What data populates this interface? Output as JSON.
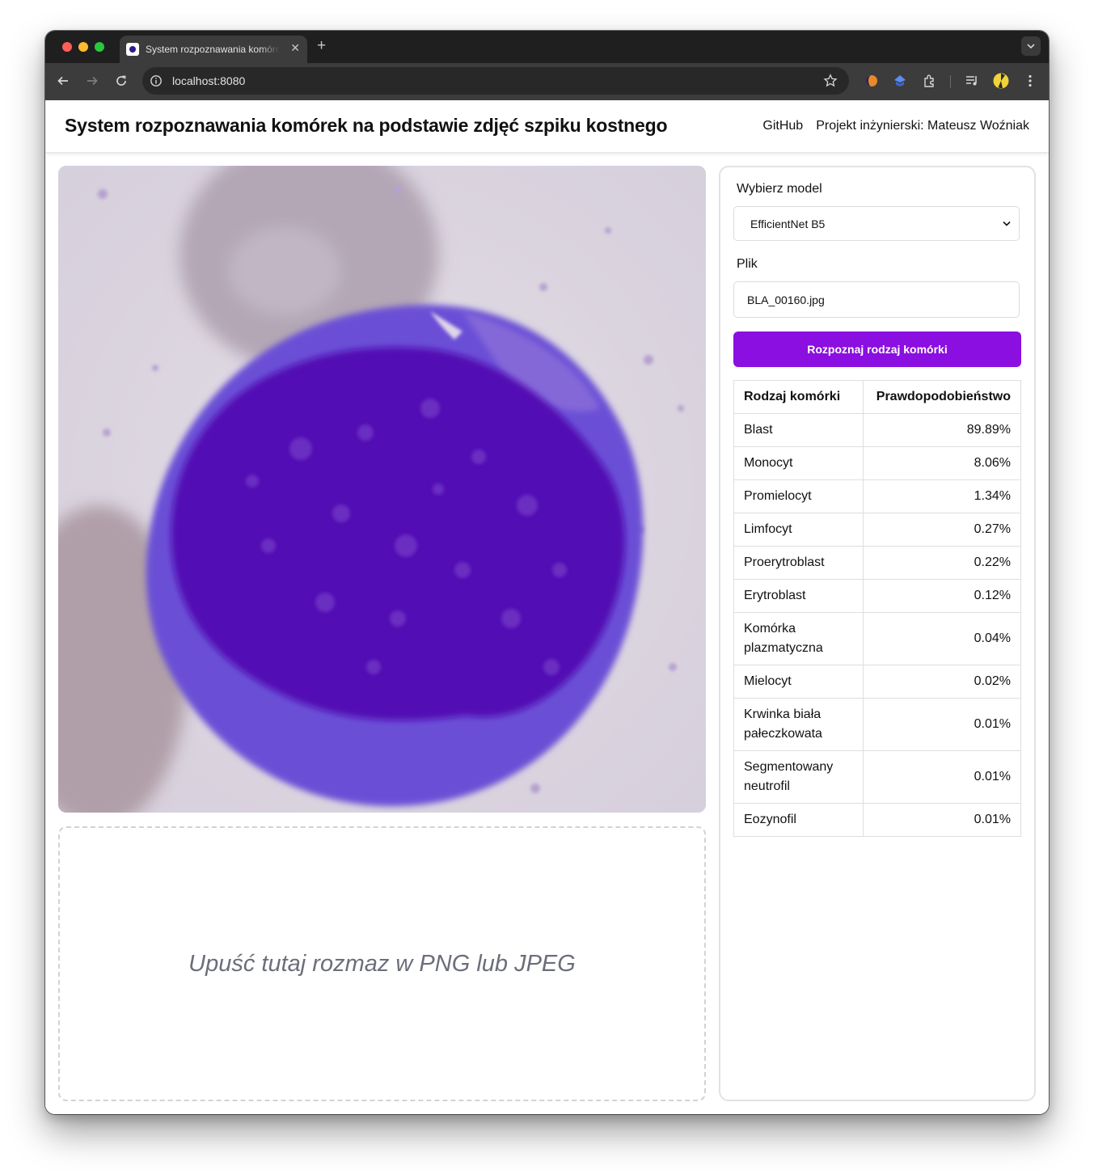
{
  "browser": {
    "tab_title": "System rozpoznawania komórek na podstawie zdjęć szpiku kostnego",
    "url": "localhost:8080",
    "traffic_lights": {
      "close": "#ff5f57",
      "minimize": "#febc2e",
      "zoom": "#28c840"
    }
  },
  "header": {
    "title": "System rozpoznawania komórek na podstawie zdjęć szpiku kostnego",
    "nav": {
      "github": "GitHub",
      "author": "Projekt inżynierski: Mateusz Woźniak"
    }
  },
  "preview": {
    "icon": "cell-microscopy-image"
  },
  "dropzone": {
    "text": "Upuść tutaj rozmaz w PNG lub JPEG"
  },
  "form": {
    "model_label": "Wybierz model",
    "model_selected": "EfficientNet B5",
    "file_label": "Plik",
    "file_value": "BLA_00160.jpg",
    "submit_label": "Rozpoznaj rodzaj komórki",
    "accent_color": "#8a0fe0"
  },
  "results": {
    "headers": [
      "Rodzaj komórki",
      "Prawdopodobieństwo"
    ],
    "rows": [
      {
        "type": "Blast",
        "probability": "89.89%"
      },
      {
        "type": "Monocyt",
        "probability": "8.06%"
      },
      {
        "type": "Promielocyt",
        "probability": "1.34%"
      },
      {
        "type": "Limfocyt",
        "probability": "0.27%"
      },
      {
        "type": "Proerytroblast",
        "probability": "0.22%"
      },
      {
        "type": "Erytroblast",
        "probability": "0.12%"
      },
      {
        "type": "Komórka plazmatyczna",
        "probability": "0.04%"
      },
      {
        "type": "Mielocyt",
        "probability": "0.02%"
      },
      {
        "type": "Krwinka biała pałeczkowata",
        "probability": "0.01%"
      },
      {
        "type": "Segmentowany neutrofil",
        "probability": "0.01%"
      },
      {
        "type": "Eozynofil",
        "probability": "0.01%"
      }
    ]
  }
}
